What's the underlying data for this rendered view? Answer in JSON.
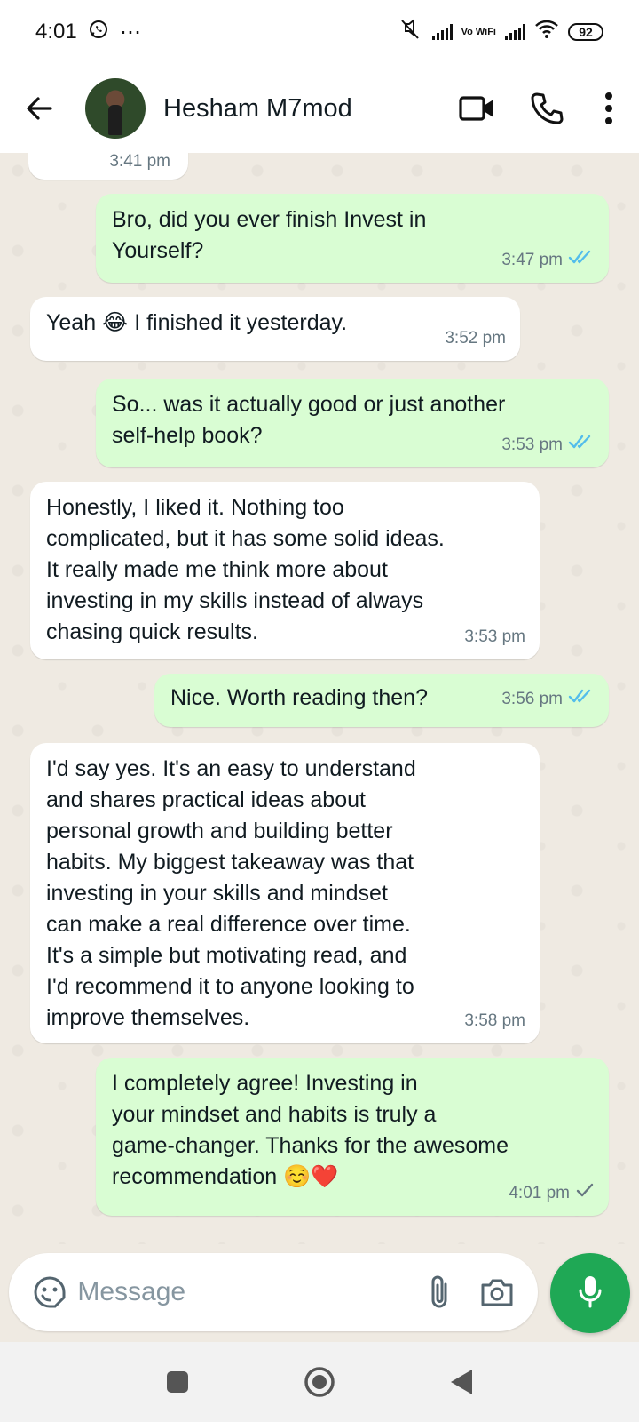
{
  "status_bar": {
    "time": "4:01",
    "more": "⋯",
    "vowifi": "Vo WiFi",
    "battery": "92"
  },
  "header": {
    "contact_name": "Hesham M7mod"
  },
  "messages": [
    {
      "direction": "in",
      "text": "",
      "time": "3:41 pm"
    },
    {
      "direction": "out",
      "text": "Bro, did you ever finish Invest in\nYourself?",
      "time": "3:47 pm",
      "status": "read"
    },
    {
      "direction": "in",
      "text": "Yeah 😂 I finished it yesterday.",
      "time": "3:52 pm"
    },
    {
      "direction": "out",
      "text": "So... was it actually good or just another\nself-help book?",
      "time": "3:53 pm",
      "status": "read"
    },
    {
      "direction": "in",
      "text": "Honestly, I liked it. Nothing too\ncomplicated, but it has some solid ideas.\nIt really made me think more about\ninvesting in my skills instead of always\nchasing quick results.",
      "time": "3:53 pm"
    },
    {
      "direction": "out",
      "text": "Nice. Worth reading then?",
      "time": "3:56 pm",
      "status": "read"
    },
    {
      "direction": "in",
      "text": "I'd say yes. It's an easy to understand\nand shares practical ideas about\npersonal growth and building better\nhabits. My biggest takeaway was that\ninvesting in your skills and mindset\ncan make a real difference over time.\nIt's a simple but motivating read, and\nI'd recommend it to anyone looking to\nimprove themselves.",
      "time": "3:58 pm"
    },
    {
      "direction": "out",
      "text": "I completely agree! Investing in\nyour mindset and habits is truly a\ngame-changer. Thanks for the awesome\nrecommendation ☺️❤️",
      "time": "4:01 pm",
      "status": "sent"
    }
  ],
  "composer": {
    "placeholder": "Message"
  },
  "colors": {
    "outgoing_bubble": "#d9fdd3",
    "incoming_bubble": "#ffffff",
    "chat_background": "#efeae2",
    "read_tick": "#53bdeb",
    "accent_green": "#1fa855"
  },
  "icons": {
    "header": [
      "back-arrow-icon",
      "video-call-icon",
      "voice-call-icon",
      "more-vert-icon"
    ],
    "composer": [
      "emoji-icon",
      "attach-icon",
      "camera-icon",
      "mic-icon"
    ],
    "nav": [
      "recents-icon",
      "home-icon",
      "back-icon"
    ]
  }
}
